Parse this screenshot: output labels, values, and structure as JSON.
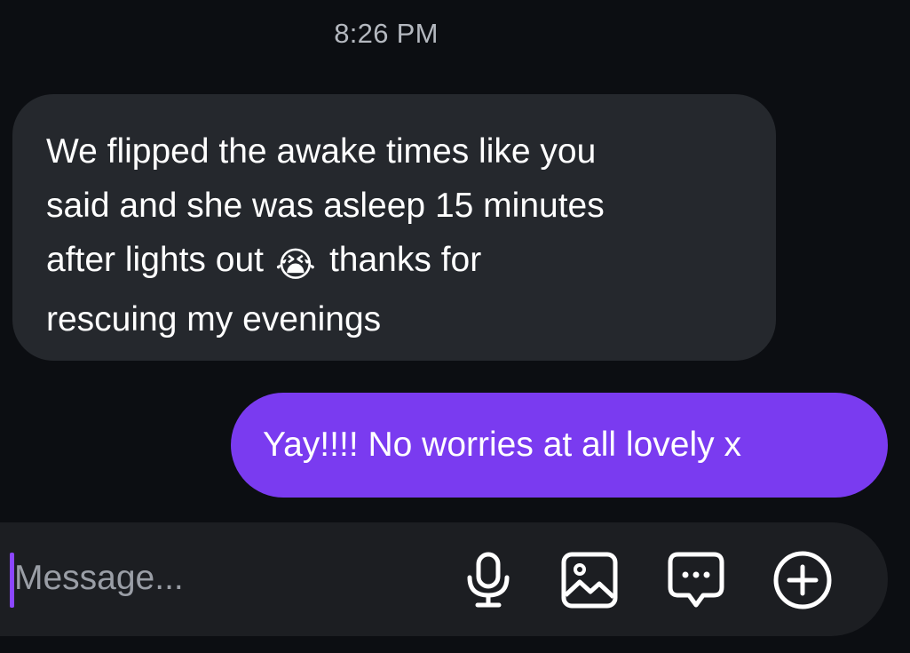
{
  "conversation": {
    "timestamp": "8:26 PM",
    "incoming_message": {
      "lines": [
        "We flipped the awake times like you",
        "said and she was asleep 15 minutes",
        "after lights out",
        "thanks for",
        "rescuing my evenings"
      ],
      "emoji": "😭"
    },
    "outgoing_message": "Yay!!!! No worries at all lovely x"
  },
  "composer": {
    "placeholder": "Message...",
    "value": "",
    "icons": [
      "microphone-icon",
      "image-icon",
      "chat-bubble-icon",
      "add-circle-icon"
    ]
  },
  "colors": {
    "background": "#0c0e12",
    "incoming_bubble": "#25282d",
    "outgoing_bubble": "#7a3bf0",
    "accent_caret": "#8b46ff"
  }
}
